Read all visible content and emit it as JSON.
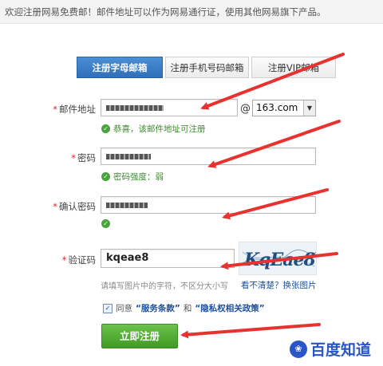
{
  "banner": {
    "text": "欢迎注册网易免费邮！邮件地址可以作为网易通行证，使用其他网易旗下产品。"
  },
  "tabs": [
    {
      "label": "注册字母邮箱",
      "active": true
    },
    {
      "label": "注册手机号码邮箱",
      "active": false
    },
    {
      "label": "注册VIP邮箱",
      "active": false
    }
  ],
  "form": {
    "email": {
      "required_mark": "*",
      "label": "邮件地址",
      "at": "@",
      "domain": "163.com",
      "hint": "恭喜，该邮件地址可注册"
    },
    "password": {
      "required_mark": "*",
      "label": "密码",
      "hint": "密码强度：弱"
    },
    "confirm": {
      "required_mark": "*",
      "label": "确认密码"
    },
    "captcha": {
      "required_mark": "*",
      "label": "验证码",
      "value": "kqeae8",
      "image_text": "KqEae8",
      "hint": "请填写图片中的字符，不区分大小写",
      "refresh_link": "看不清楚？换张图片"
    },
    "agree": {
      "prefix": "同意",
      "service_terms": "“服务条款”",
      "and": "和",
      "privacy_policy": "“隐私权相关政策”"
    },
    "submit_label": "立即注册"
  },
  "watermark": {
    "text": "百度知道"
  },
  "colors": {
    "tab_active": "#2f6fb8",
    "success": "#3c8a2e",
    "submit": "#4fa82f",
    "arrow": "#e8322f",
    "link": "#1d4f9c"
  }
}
